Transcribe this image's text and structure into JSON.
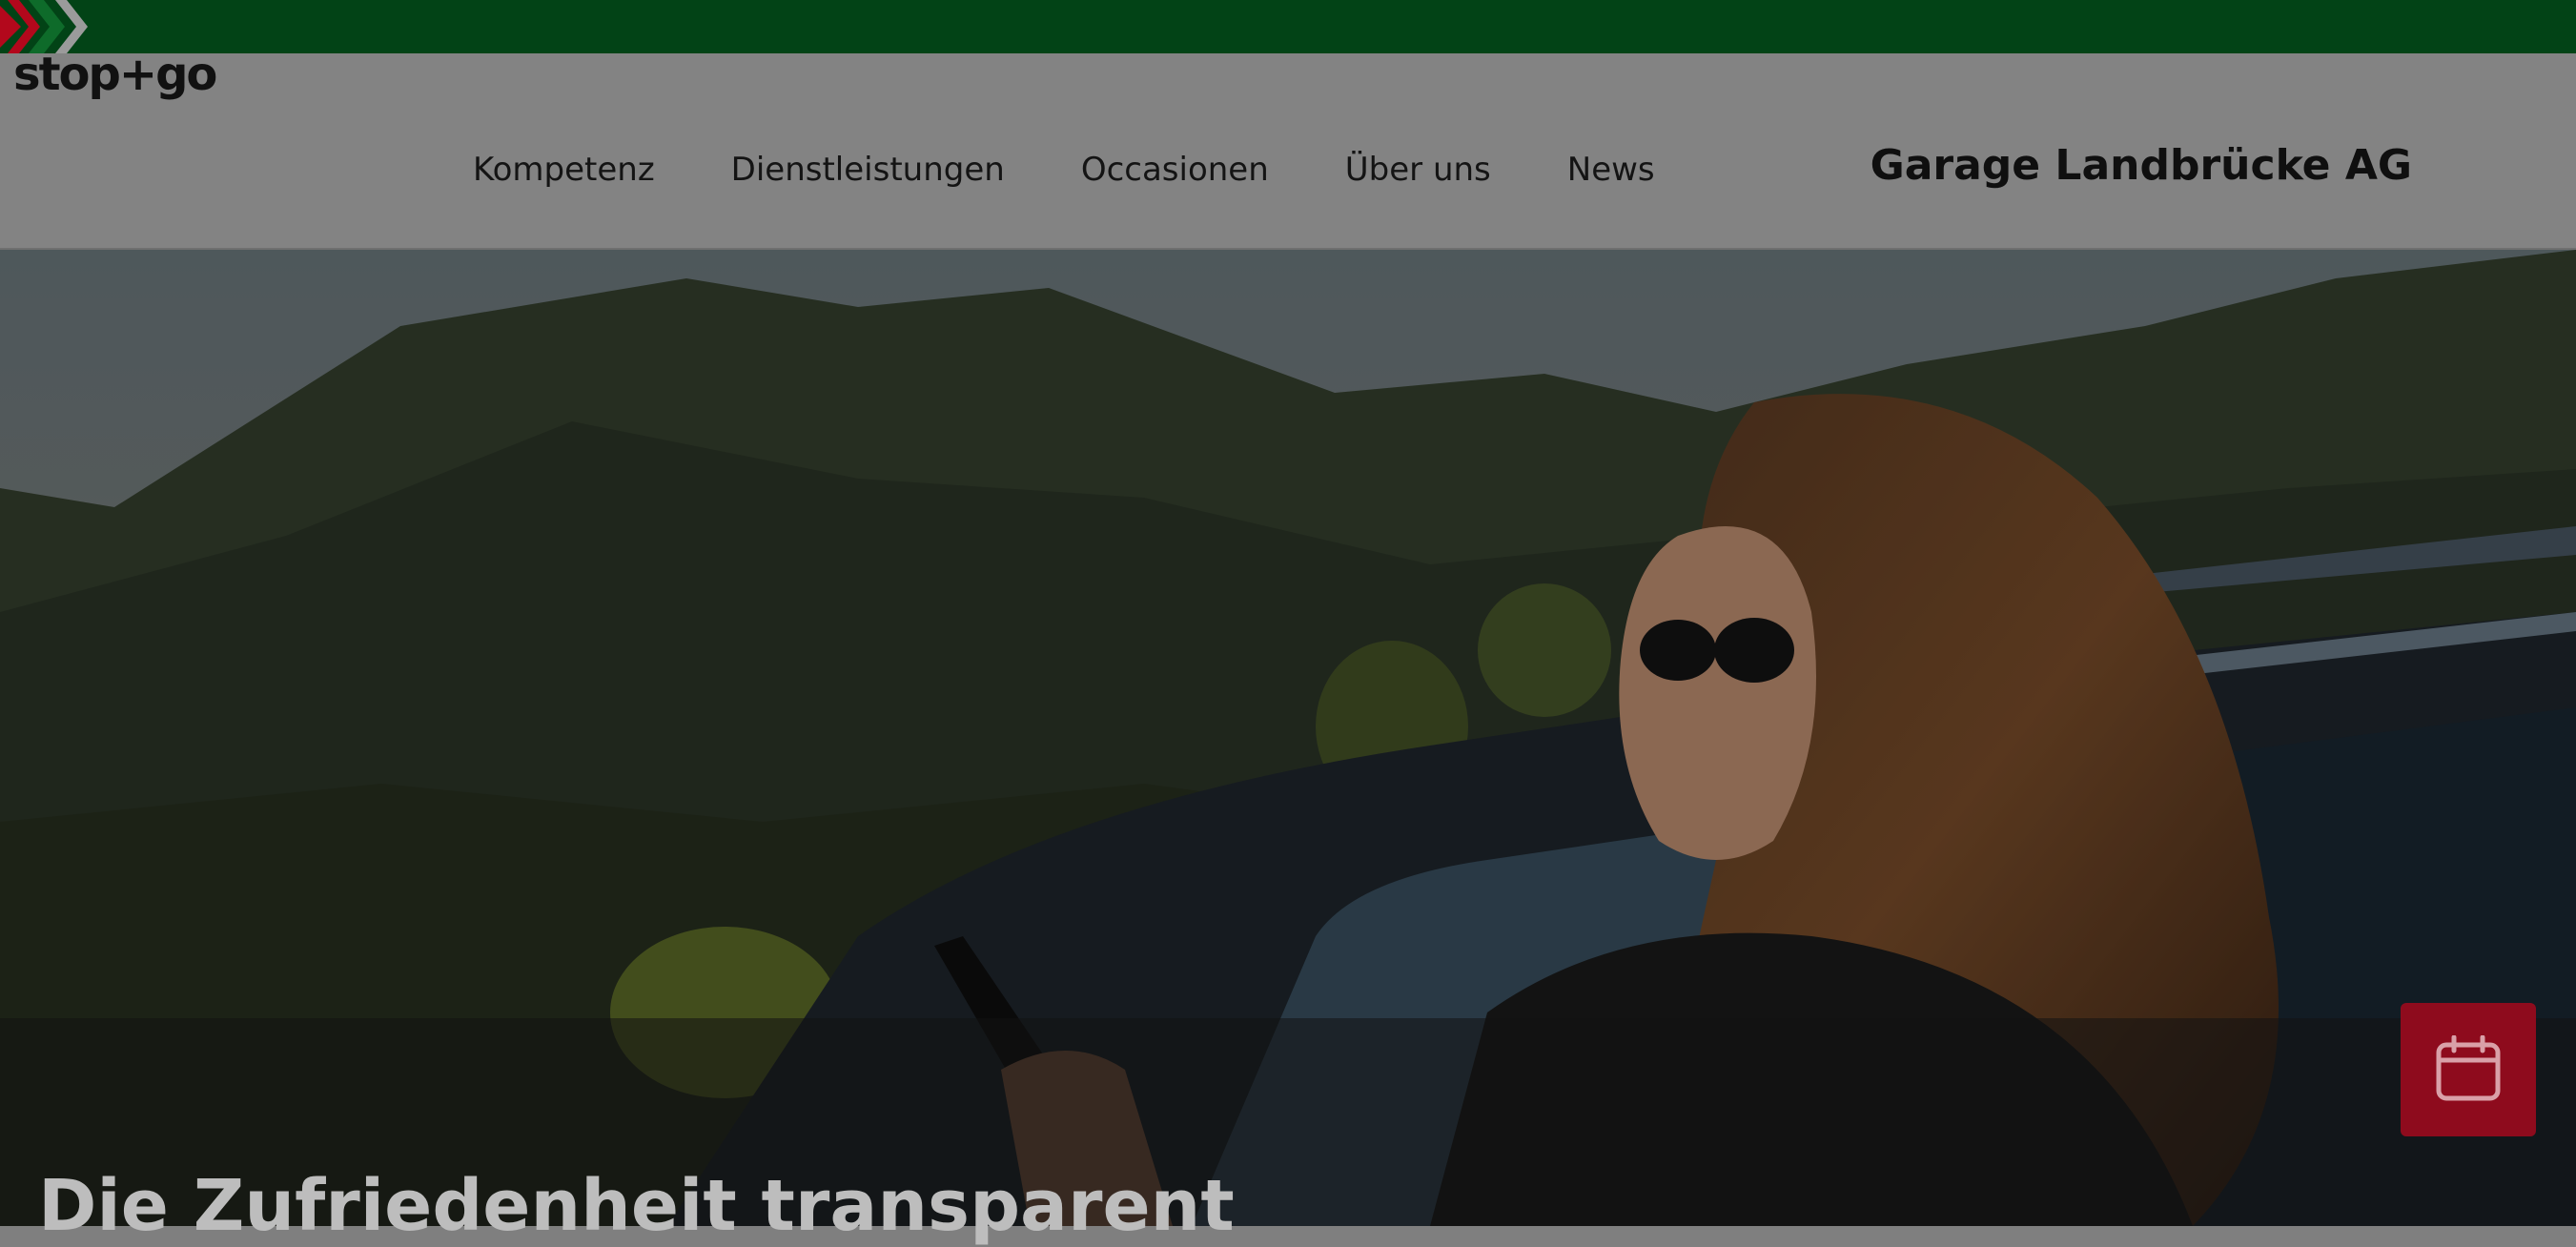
{
  "brand": {
    "logo_text": "stop+go",
    "company_name": "Garage Landbrücke AG"
  },
  "nav": {
    "items": [
      {
        "label": "Kompetenz"
      },
      {
        "label": "Dienstleistungen"
      },
      {
        "label": "Occasionen"
      },
      {
        "label": "Über uns"
      },
      {
        "label": "News"
      }
    ]
  },
  "hero": {
    "headline": "Die Zufriedenheit transparent",
    "calendar_icon": "calendar-icon"
  },
  "colors": {
    "topbar": "#024316",
    "logo_red": "#b3081c",
    "logo_green": "#0e6b2a",
    "calendar_button": "#8e0b1d"
  }
}
